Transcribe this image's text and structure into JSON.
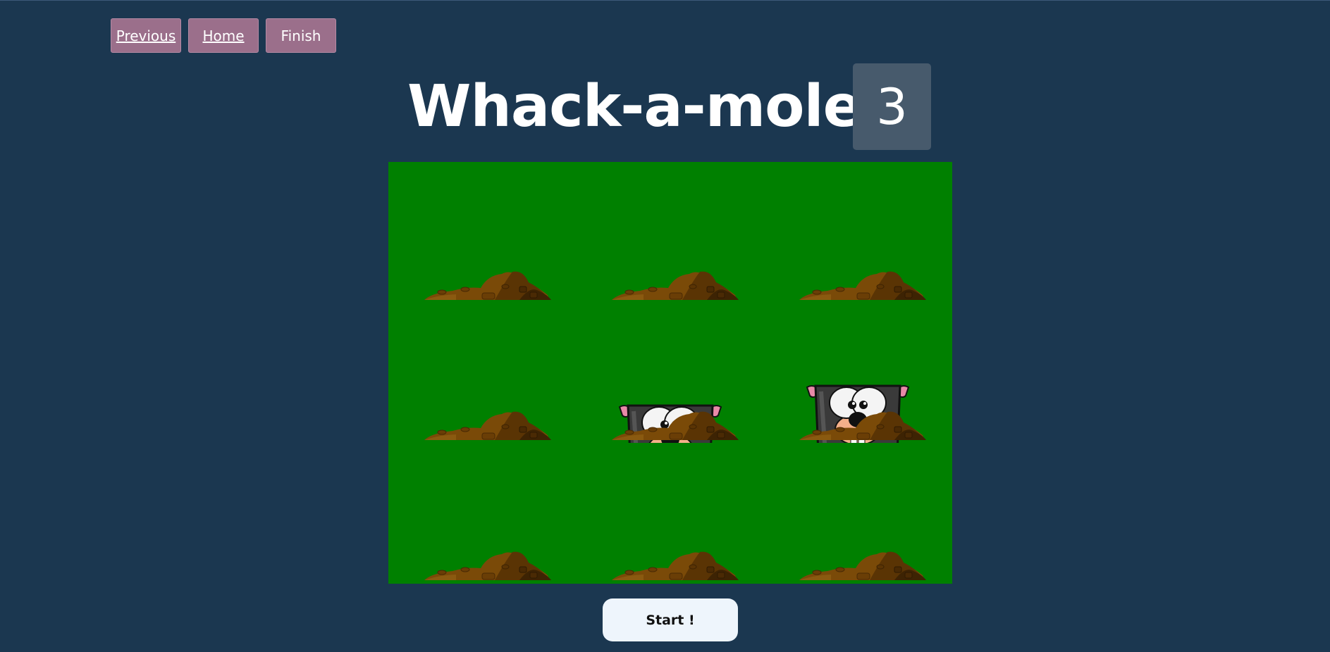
{
  "nav": {
    "previous_label": "Previous",
    "home_label": "Home",
    "finish_label": "Finish"
  },
  "game": {
    "title": "Whack-a-mole!",
    "score": "3",
    "start_label": "Start !"
  },
  "board": {
    "rows": 3,
    "cols": 3,
    "holes": [
      {
        "row": 0,
        "col": 0,
        "mole": "none"
      },
      {
        "row": 0,
        "col": 1,
        "mole": "none"
      },
      {
        "row": 0,
        "col": 2,
        "mole": "none"
      },
      {
        "row": 1,
        "col": 0,
        "mole": "none"
      },
      {
        "row": 1,
        "col": 1,
        "mole": "peeking"
      },
      {
        "row": 1,
        "col": 2,
        "mole": "up"
      },
      {
        "row": 2,
        "col": 0,
        "mole": "none"
      },
      {
        "row": 2,
        "col": 1,
        "mole": "none"
      },
      {
        "row": 2,
        "col": 2,
        "mole": "none"
      }
    ]
  },
  "colors": {
    "background": "#1b3750",
    "board": "#008000",
    "nav_button": "#9b6f8b",
    "score_box": "#475a6c",
    "dirt": "#7a4a08",
    "mole_body": "#3a3a3a"
  }
}
